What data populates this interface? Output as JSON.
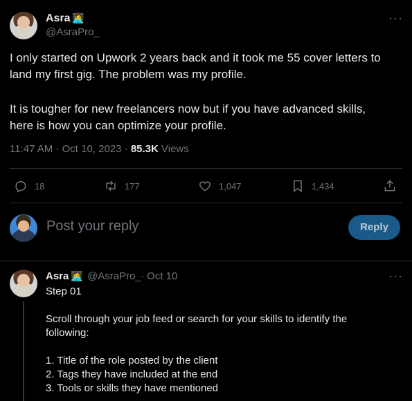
{
  "main_tweet": {
    "author_name": "Asra",
    "author_emoji": "👩‍💻",
    "author_handle": "@AsraPro_",
    "paragraph1_line1": "I only started on Upwork 2 years back and it took me 55 cover letters to",
    "paragraph1_line2": "land my first gig. The problem was my profile.",
    "paragraph2_line1": "It is tougher for new freelancers now but if you have advanced skills,",
    "paragraph2_line2": "here is how you can optimize your profile.",
    "time": "11:47 AM · Oct 10, 2023 · ",
    "views_count": "85.3K",
    "views_label": " Views"
  },
  "actions": {
    "replies": "18",
    "reposts": "177",
    "likes": "1,047",
    "bookmarks": "1,434"
  },
  "reply_box": {
    "placeholder": "Post your reply",
    "button_label": "Reply"
  },
  "thread_reply": {
    "author_name": "Asra",
    "author_emoji": "👩‍💻",
    "author_handle": "@AsraPro_",
    "date": "· Oct 10",
    "title": "Step 01",
    "line1": "Scroll through your job feed or search for your skills to identify the",
    "line2": "following:",
    "item1": "1. Title of the role posted by the client",
    "item2": "2. Tags they have included at the end",
    "item3": "3. Tools or skills they have mentioned"
  },
  "icons": {
    "more": "more-dots-icon",
    "reply": "reply-bubble-icon",
    "repost": "repost-icon",
    "like": "heart-icon",
    "bookmark": "bookmark-icon",
    "share": "share-icon"
  },
  "colors": {
    "background": "#000000",
    "text": "#e7e9ea",
    "muted": "#71767b",
    "reply_button": "#1a5a89",
    "divider": "#2f3336"
  }
}
